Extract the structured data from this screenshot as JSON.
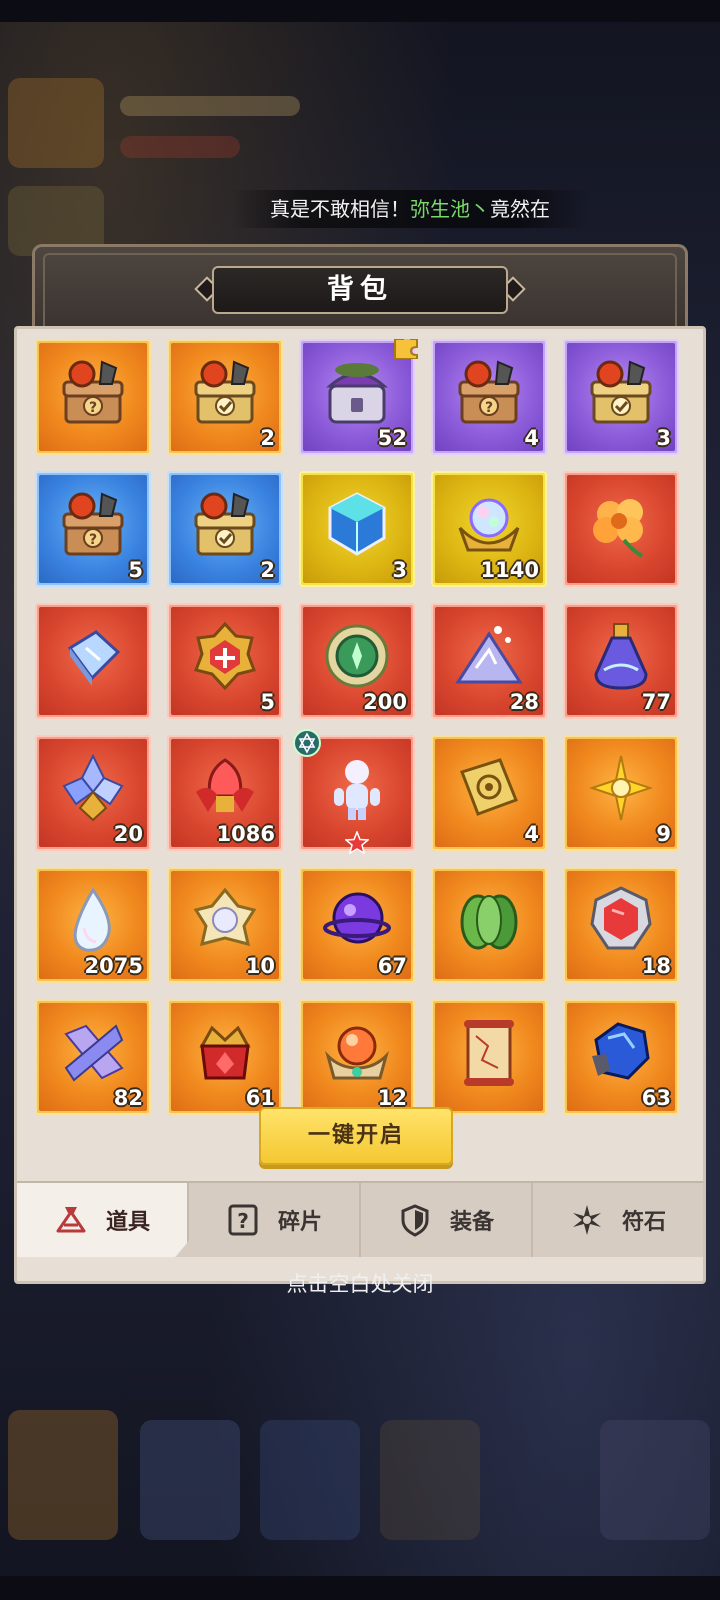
{
  "ticker": {
    "prefix": "真是不敢相信！",
    "highlight": "弥生池丶",
    "suffix": "竟然在"
  },
  "panel": {
    "title": "背包"
  },
  "items": [
    {
      "rarity": "orange",
      "icon": "mystery-chest-icon",
      "qty": ""
    },
    {
      "rarity": "orange",
      "icon": "selector-chest-icon",
      "qty": "2"
    },
    {
      "rarity": "purple",
      "icon": "purple-treasure-chest-icon",
      "qty": "52",
      "badge": "puzzle"
    },
    {
      "rarity": "purple",
      "icon": "mystery-chest-icon",
      "qty": "4"
    },
    {
      "rarity": "purple",
      "icon": "selector-chest-icon",
      "qty": "3"
    },
    {
      "rarity": "blue",
      "icon": "mystery-chest-icon",
      "qty": "5"
    },
    {
      "rarity": "blue",
      "icon": "selector-chest-icon",
      "qty": "2"
    },
    {
      "rarity": "gold",
      "icon": "crystal-cube-icon",
      "qty": "3"
    },
    {
      "rarity": "gold",
      "icon": "rainbow-pearl-crown-icon",
      "qty": "1140"
    },
    {
      "rarity": "red",
      "icon": "orange-flower-icon",
      "qty": ""
    },
    {
      "rarity": "red",
      "icon": "ice-cube-icon",
      "qty": ""
    },
    {
      "rarity": "red",
      "icon": "red-emblem-icon",
      "qty": "5"
    },
    {
      "rarity": "red",
      "icon": "green-emblem-icon",
      "qty": "200"
    },
    {
      "rarity": "red",
      "icon": "stardust-pile-icon",
      "qty": "28"
    },
    {
      "rarity": "red",
      "icon": "potion-flask-icon",
      "qty": "77"
    },
    {
      "rarity": "red",
      "icon": "crystal-cluster-icon",
      "qty": "20"
    },
    {
      "rarity": "red",
      "icon": "red-crystal-flower-icon",
      "qty": "1086"
    },
    {
      "rarity": "red",
      "icon": "glowing-figure-icon",
      "qty": "",
      "badge": "hero-star"
    },
    {
      "rarity": "orange",
      "icon": "gold-book-icon",
      "qty": "4"
    },
    {
      "rarity": "orange",
      "icon": "gold-sun-icon",
      "qty": "9"
    },
    {
      "rarity": "orange",
      "icon": "water-drop-icon",
      "qty": "2075"
    },
    {
      "rarity": "orange",
      "icon": "white-gem-flower-icon",
      "qty": "10"
    },
    {
      "rarity": "orange",
      "icon": "purple-orb-icon",
      "qty": "67"
    },
    {
      "rarity": "orange",
      "icon": "green-leaf-bundle-icon",
      "qty": ""
    },
    {
      "rarity": "orange",
      "icon": "red-gem-icon",
      "qty": "18"
    },
    {
      "rarity": "orange",
      "icon": "crystal-shards-icon",
      "qty": "82"
    },
    {
      "rarity": "orange",
      "icon": "red-flame-crown-icon",
      "qty": "61"
    },
    {
      "rarity": "orange",
      "icon": "fire-orb-icon",
      "qty": "12"
    },
    {
      "rarity": "orange",
      "icon": "scroll-map-icon",
      "qty": ""
    },
    {
      "rarity": "orange",
      "icon": "blue-ore-icon",
      "qty": "63"
    }
  ],
  "open_all_button": "一键开启",
  "tabs": [
    {
      "label": "道具",
      "icon": "item-bag-icon",
      "active": true
    },
    {
      "label": "碎片",
      "icon": "fragment-icon",
      "active": false
    },
    {
      "label": "装备",
      "icon": "shield-icon",
      "active": false
    },
    {
      "label": "符石",
      "icon": "rune-star-icon",
      "active": false
    }
  ],
  "close_hint": "点击空白处关闭",
  "colors": {
    "accent_button": "#f4c832",
    "panel_bg": "#e7ded6",
    "ticker_highlight": "#7bd96a"
  }
}
